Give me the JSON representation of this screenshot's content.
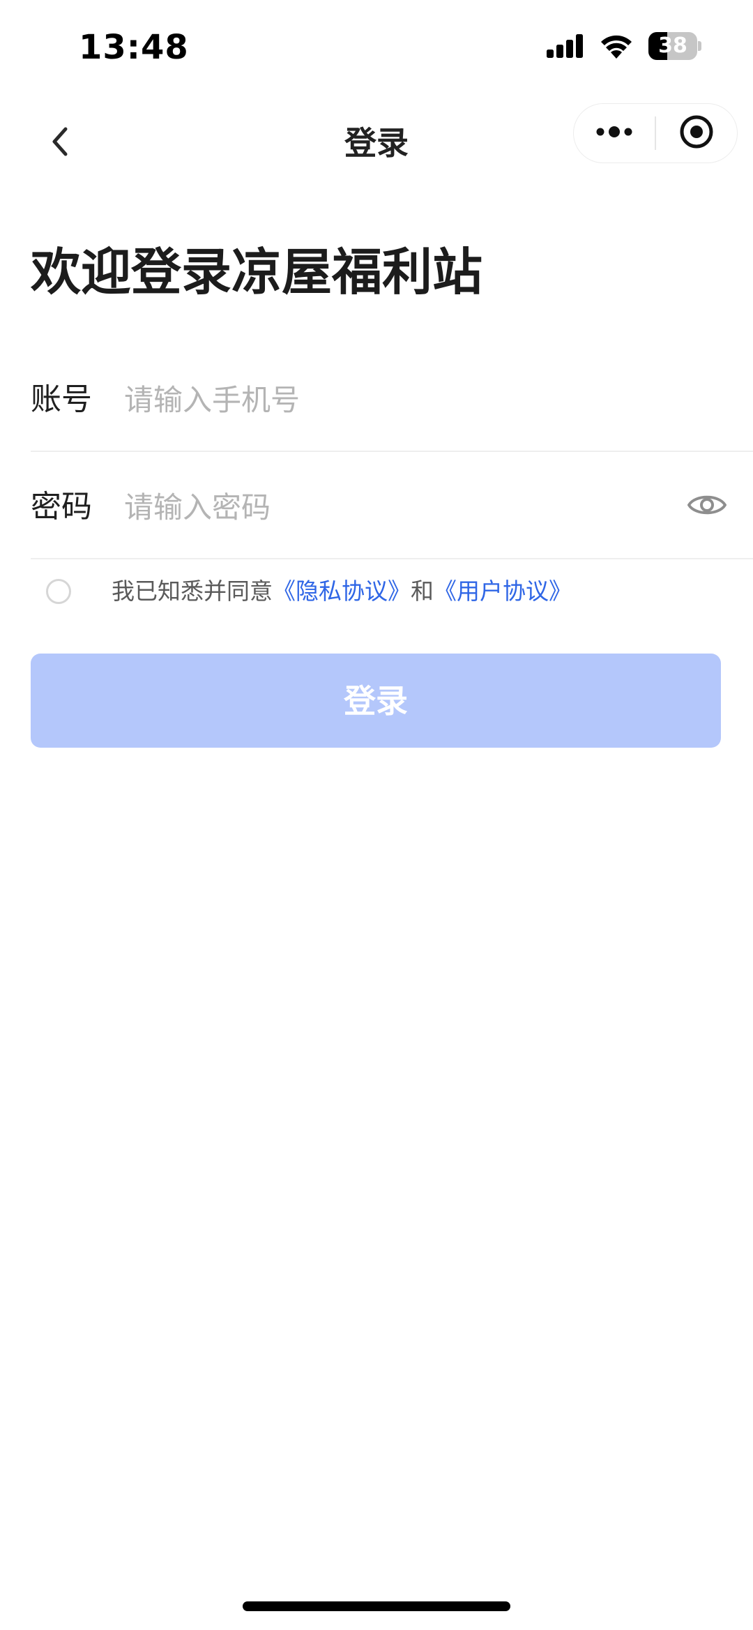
{
  "status_bar": {
    "time": "13:48",
    "battery_level": "38",
    "battery_fraction": 0.38,
    "icons": [
      "cellular-signal-icon",
      "wifi-icon",
      "battery-icon"
    ]
  },
  "nav": {
    "title": "登录",
    "back_icon": "chevron-left-icon",
    "menu_icon": "more-dots-icon",
    "close_icon": "target-circle-icon"
  },
  "page": {
    "heading": "欢迎登录凉屋福利站"
  },
  "form": {
    "account": {
      "label": "账号",
      "placeholder": "请输入手机号",
      "value": ""
    },
    "password": {
      "label": "密码",
      "placeholder": "请输入密码",
      "value": "",
      "toggle_icon": "eye-icon"
    }
  },
  "agreement": {
    "checked": false,
    "prefix": "我已知悉并同意",
    "privacy_link": "《隐私协议》",
    "conjunction": "和",
    "user_link": "《用户协议》"
  },
  "login_button": {
    "label": "登录"
  },
  "colors": {
    "accent": "#2f66e6",
    "button_disabled": "#b4c7fb",
    "placeholder": "#b4b4b4",
    "divider": "#eeeeee"
  }
}
